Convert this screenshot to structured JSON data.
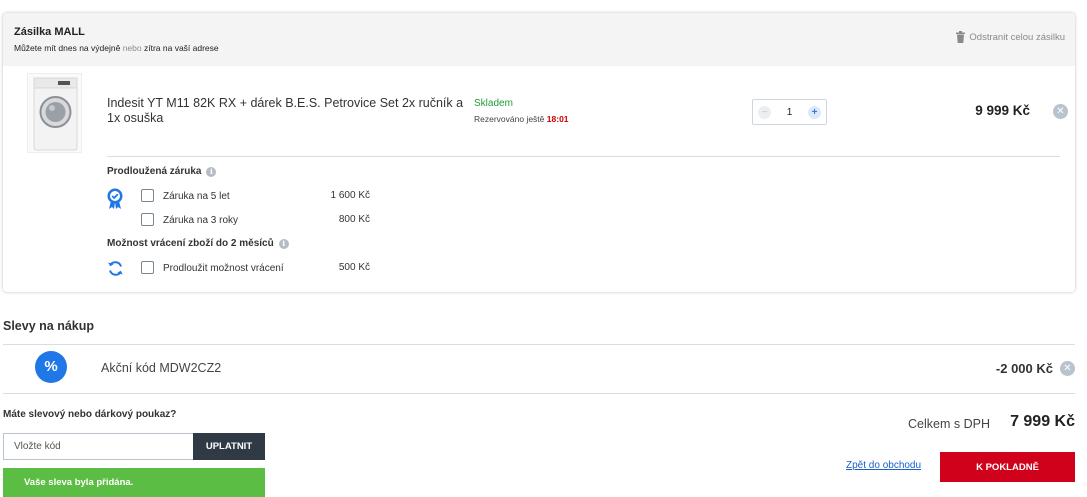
{
  "shipment": {
    "title": "Zásilka MALL",
    "subtitle_part1": "Můžete mít dnes na výdejně",
    "subtitle_or": "nebo",
    "subtitle_part2": "zítra na vaší adrese",
    "remove_all_label": "Odstranit celou zásilku"
  },
  "product": {
    "name": "Indesit YT M11 82K RX + dárek B.E.S. Petrovice Set 2x ručník a 1x osuška",
    "stock_status": "Skladem",
    "reserved_label": "Rezervováno ještě",
    "reserved_time": "18:01",
    "quantity": "1",
    "price": "9 999 Kč"
  },
  "warranty": {
    "title": "Prodloužená záruka",
    "options": [
      {
        "label": "Záruka na 5 let",
        "price": "1 600 Kč"
      },
      {
        "label": "Záruka na 3 roky",
        "price": "800 Kč"
      }
    ]
  },
  "returns": {
    "title": "Možnost vrácení zboží do 2 měsíců",
    "options": [
      {
        "label": "Prodloužit možnost vrácení",
        "price": "500 Kč"
      }
    ]
  },
  "discounts": {
    "title": "Slevy na nákup",
    "percent_symbol": "%",
    "code_label": "Akční kód MDW2CZ2",
    "amount": "-2 000 Kč"
  },
  "voucher": {
    "question": "Máte slevový nebo dárkový poukaz?",
    "input_value": "",
    "input_placeholder": "Vložte kód",
    "apply_label": "UPLATNIT",
    "success_message": "Vaše sleva byla přidána."
  },
  "summary": {
    "total_label": "Celkem s DPH",
    "total_value": "7 999 Kč",
    "back_link": "Zpět do obchodu",
    "checkout_label": "K POKLADNĚ"
  },
  "colors": {
    "accent_blue": "#1f77e8",
    "stock_green": "#1f9e3a",
    "reserve_red": "#cc0000",
    "success_green": "#5cbd45",
    "checkout_red": "#d0021b",
    "dark_button": "#2f3a44"
  }
}
